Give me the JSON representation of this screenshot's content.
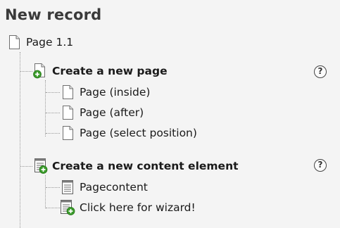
{
  "header": {
    "title": "New record"
  },
  "root": {
    "label": "Page 1.1",
    "icon": "page-icon"
  },
  "sections": [
    {
      "title": "Create a new page",
      "icon": "new-page-icon",
      "help_symbol": "?",
      "items": [
        {
          "label": "Page (inside)",
          "icon": "page-icon"
        },
        {
          "label": "Page (after)",
          "icon": "page-icon"
        },
        {
          "label": "Page (select position)",
          "icon": "page-icon"
        }
      ]
    },
    {
      "title": "Create a new content element",
      "icon": "new-content-element-icon",
      "help_symbol": "?",
      "items": [
        {
          "label": "Pagecontent",
          "icon": "content-element-icon"
        },
        {
          "label": "Click here for wizard!",
          "icon": "wizard-icon"
        }
      ]
    }
  ],
  "colors": {
    "background": "#f4f4f4",
    "title": "#3a3a3a",
    "add_badge": "#3a9a2a"
  }
}
